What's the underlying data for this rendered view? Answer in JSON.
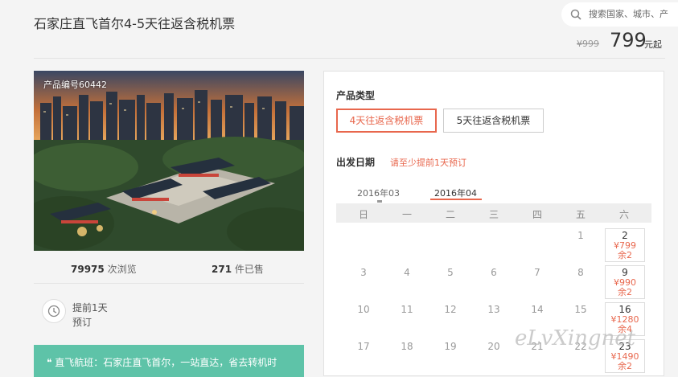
{
  "page": {
    "title": "石家庄直飞首尔4-5天往返含税机票"
  },
  "search": {
    "placeholder": "搜索国家、城市、产"
  },
  "pricing": {
    "original_price": "¥999",
    "price": "799",
    "price_suffix": "元起"
  },
  "product": {
    "code_label": "产品编号60442",
    "views_count": "79975",
    "views_label": "次浏览",
    "sold_count": "271",
    "sold_label": "件已售",
    "advance_line1": "提前1天",
    "advance_line2": "预订",
    "banner": "❝ 直飞航班：石家庄直飞首尔，一站直达，省去转机时"
  },
  "booking": {
    "type_label": "产品类型",
    "types": [
      "4天往返含税机票",
      "5天往返含税机票"
    ],
    "selected_type": "4天往返含税机票",
    "date_label": "出发日期",
    "date_hint": "请至少提前1天预订",
    "months": [
      "2016年03",
      "2016年04"
    ],
    "selected_month": "2016年04",
    "weekdays": [
      "日",
      "一",
      "二",
      "三",
      "四",
      "五",
      "六"
    ],
    "rows": [
      {
        "days": [
          "",
          "",
          "",
          "",
          "",
          "1"
        ],
        "sat": {
          "day": "2",
          "price": "¥799",
          "remain": "余2"
        }
      },
      {
        "days": [
          "3",
          "4",
          "5",
          "6",
          "7",
          "8"
        ],
        "sat": {
          "day": "9",
          "price": "¥990",
          "remain": "余2"
        }
      },
      {
        "days": [
          "10",
          "11",
          "12",
          "13",
          "14",
          "15"
        ],
        "sat": {
          "day": "16",
          "price": "¥1280",
          "remain": "余4"
        }
      },
      {
        "days": [
          "17",
          "18",
          "19",
          "20",
          "21",
          "22"
        ],
        "sat": {
          "day": "23",
          "price": "¥1490",
          "remain": "余2"
        }
      }
    ]
  },
  "watermark": "eLvXingnet",
  "colors": {
    "accent": "#e8674d",
    "banner": "#5ec3a8",
    "background": "#f4f4f4"
  }
}
